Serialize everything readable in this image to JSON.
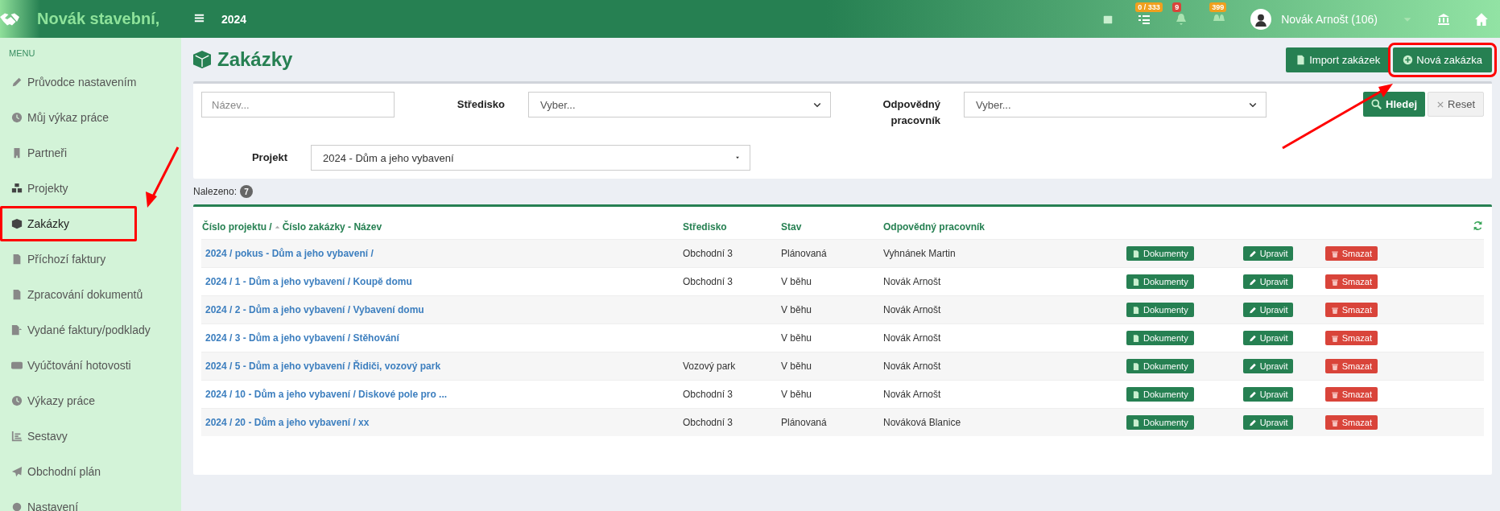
{
  "header": {
    "brand": "Novák stavební,",
    "year": "2024",
    "badges": [
      {
        "text": "0 / 333",
        "color": "#f0a01e"
      },
      {
        "text": "9",
        "color": "#d9443a"
      },
      {
        "text": "399",
        "color": "#f0a01e"
      }
    ],
    "user": "Novák Arnošt (106)"
  },
  "sidebar": {
    "title": "MENU",
    "items": [
      {
        "label": "Průvodce nastavením",
        "selected": false,
        "highlighted": false
      },
      {
        "label": "Můj výkaz práce",
        "selected": false,
        "highlighted": false
      },
      {
        "label": "Partneři",
        "selected": false,
        "highlighted": false
      },
      {
        "label": "Projekty",
        "selected": false,
        "highlighted": false
      },
      {
        "label": "Zakázky",
        "selected": true,
        "highlighted": true
      },
      {
        "label": "Příchozí faktury",
        "selected": false,
        "highlighted": false
      },
      {
        "label": "Zpracování dokumentů",
        "selected": false,
        "highlighted": false
      },
      {
        "label": "Vydané faktury/podklady",
        "selected": false,
        "highlighted": false
      },
      {
        "label": "Vyúčtování hotovosti",
        "selected": false,
        "highlighted": false
      },
      {
        "label": "Výkazy práce",
        "selected": false,
        "highlighted": false
      },
      {
        "label": "Sestavy",
        "selected": false,
        "highlighted": false
      },
      {
        "label": "Obchodní plán",
        "selected": false,
        "highlighted": false
      },
      {
        "label": "Nastavení",
        "selected": false,
        "highlighted": false
      }
    ]
  },
  "page": {
    "title": "Zakázky",
    "buttons": [
      {
        "label": "Import zakázek",
        "highlighted": false
      },
      {
        "label": "Nová zakázka",
        "highlighted": true
      }
    ]
  },
  "filter": {
    "name_placeholder": "Název...",
    "stredisko_label": "Středisko",
    "stredisko_value": "Vyber...",
    "pracovnik_label": "Odpovědný pracovník",
    "pracovnik_value": "Vyber...",
    "search_button": "Hledej",
    "reset_button": "Reset",
    "projekt_label": "Projekt",
    "projekt_value": "2024 - Dům a jeho vybavení"
  },
  "found": {
    "label": "Nalezeno:",
    "count": "7"
  },
  "table": {
    "columns": [
      "Číslo projektu /",
      "Číslo zakázky - Název",
      "Středisko",
      "Stav",
      "Odpovědný pracovník"
    ],
    "rows": [
      {
        "title": "2024 / pokus - Dům a jeho vybavení /",
        "stredisko": "Obchodní 3",
        "stav": "Plánovaná",
        "pracovnik": "Vyhnánek Martin",
        "actions": [
          "Dokumenty",
          "Upravit",
          "Smazat"
        ]
      },
      {
        "title": "2024 / 1 - Dům a jeho vybavení / Koupě domu",
        "stredisko": "Obchodní 3",
        "stav": "V běhu",
        "pracovnik": "Novák Arnošt",
        "actions": [
          "Dokumenty",
          "Upravit",
          "Smazat"
        ]
      },
      {
        "title": "2024 / 2 - Dům a jeho vybavení / Vybavení domu",
        "stredisko": "",
        "stav": "V běhu",
        "pracovnik": "Novák Arnošt",
        "actions": [
          "Dokumenty",
          "Upravit",
          "Smazat"
        ]
      },
      {
        "title": "2024 / 3 - Dům a jeho vybavení / Stěhování",
        "stredisko": "",
        "stav": "V běhu",
        "pracovnik": "Novák Arnošt",
        "actions": [
          "Dokumenty",
          "Upravit",
          "Smazat"
        ]
      },
      {
        "title": "2024 / 5 - Dům a jeho vybavení / Řidiči, vozový park",
        "stredisko": "Vozový park",
        "stav": "V běhu",
        "pracovnik": "Novák Arnošt",
        "actions": [
          "Dokumenty",
          "Upravit",
          "Smazat"
        ]
      },
      {
        "title": "2024 / 10 - Dům a jeho vybavení / Diskové pole pro ...",
        "stredisko": "Obchodní 3",
        "stav": "V běhu",
        "pracovnik": "Novák Arnošt",
        "actions": [
          "Dokumenty",
          "Upravit",
          "Smazat"
        ]
      },
      {
        "title": "2024 / 20 - Dům a jeho vybavení / xx",
        "stredisko": "Obchodní 3",
        "stav": "Plánovaná",
        "pracovnik": "Nováková Blanice",
        "actions": [
          "Dokumenty",
          "Upravit",
          "Smazat"
        ]
      }
    ]
  }
}
